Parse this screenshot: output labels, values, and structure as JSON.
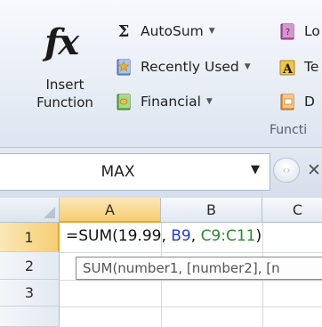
{
  "ribbon": {
    "insert_function": {
      "icon_text": "fx",
      "label": "Insert\nFunction"
    },
    "library_buttons": [
      {
        "label": "AutoSum",
        "icon": "sigma-icon",
        "caret": "▼"
      },
      {
        "label": "Recently Used",
        "icon": "star-book-icon",
        "caret": "▼"
      },
      {
        "label": "Financial",
        "icon": "financial-book-icon",
        "caret": "▼"
      }
    ],
    "clipped_buttons": [
      {
        "label": "Lo",
        "icon": "logical-book-icon"
      },
      {
        "label": "Te",
        "icon": "text-book-icon"
      },
      {
        "label": "D",
        "icon": "date-book-icon"
      }
    ],
    "group_label": "Functi"
  },
  "formula_bar": {
    "name_box": "MAX",
    "dropdown_arrow": "▼",
    "cancel_symbol": "✕"
  },
  "grid": {
    "columns": [
      "A",
      "B",
      "C"
    ],
    "rows": [
      "1",
      "2",
      "3"
    ],
    "active_column": "A",
    "active_row": "1",
    "cell_formula": {
      "prefix": "=SUM(19.99, ",
      "ref1": "B9",
      "sep": ", ",
      "ref2": "C9:C11",
      "suffix": ")"
    },
    "tooltip": "SUM(number1, [number2], [n"
  },
  "colors": {
    "ref1": "#1f3fcf",
    "ref2": "#2b8a2b",
    "active_header": "#f6cd74"
  }
}
